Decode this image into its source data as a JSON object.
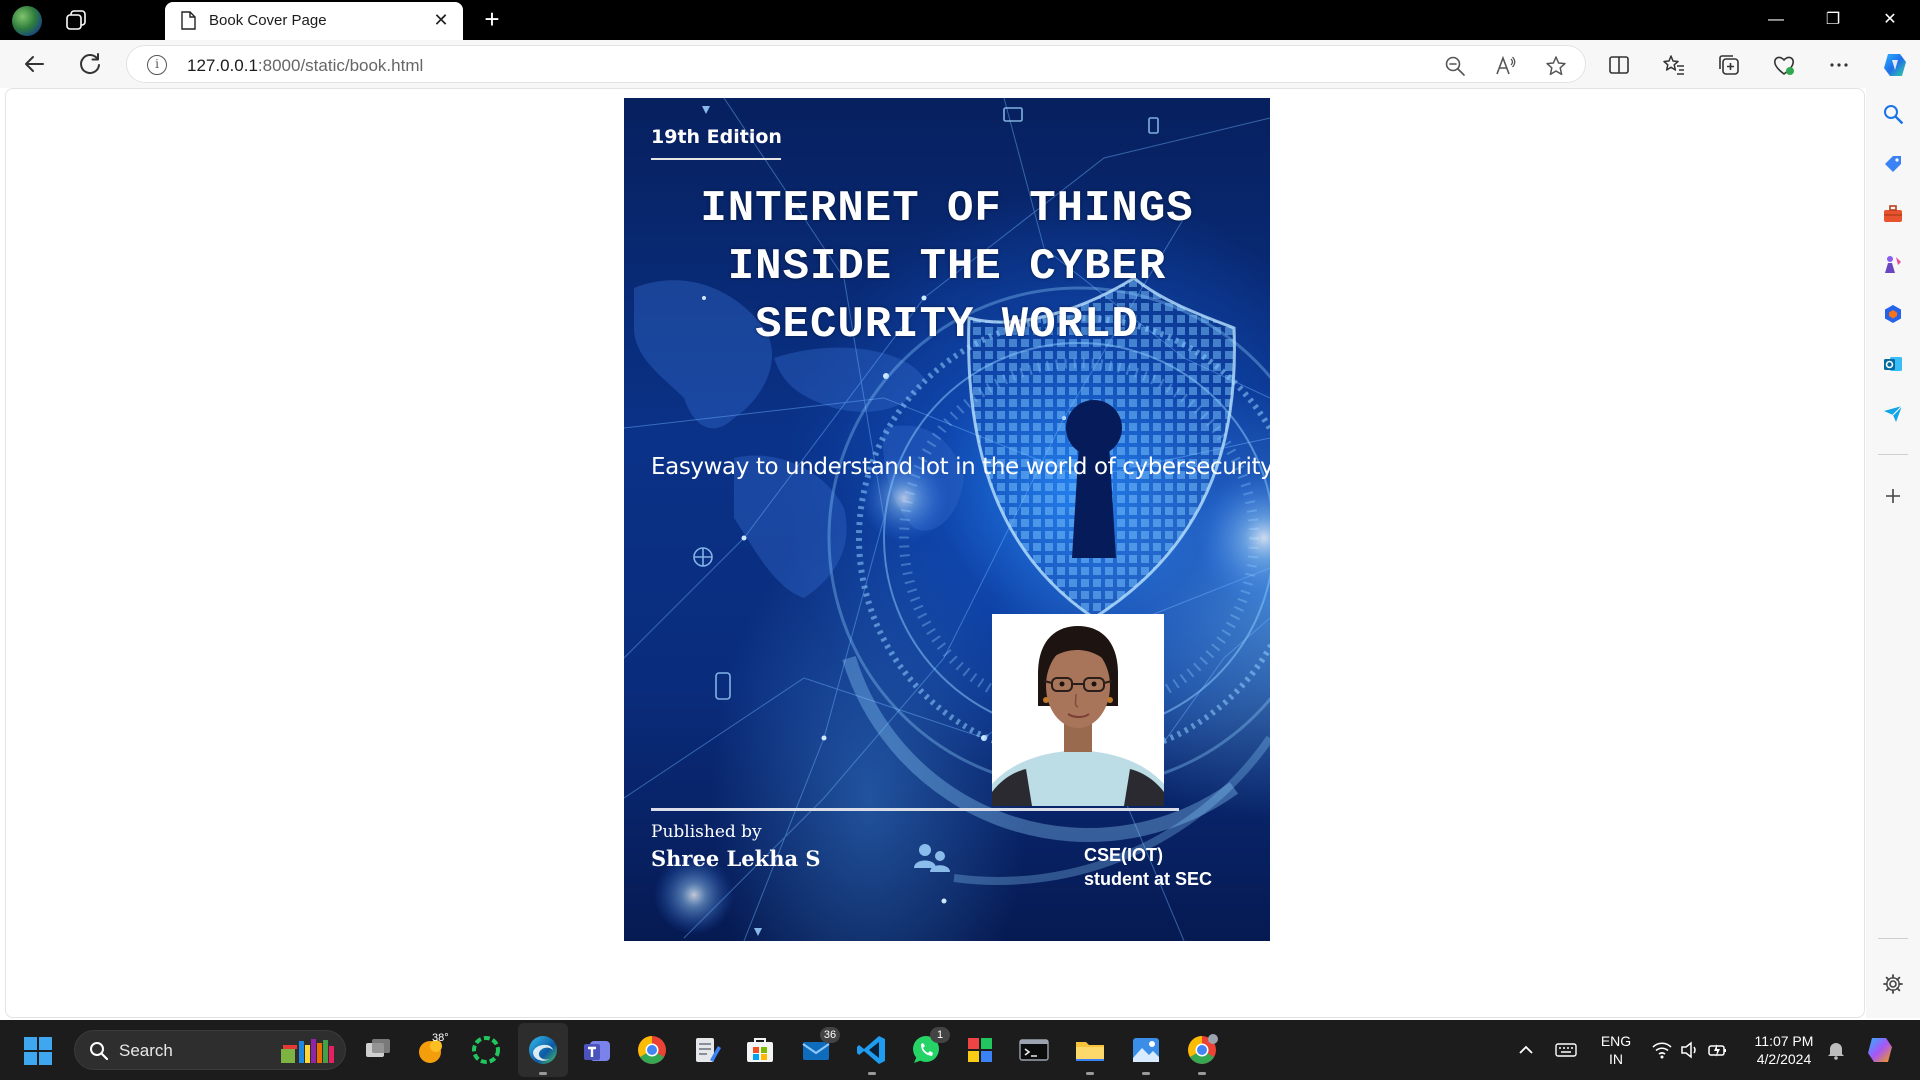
{
  "browser": {
    "tab": {
      "title": "Book Cover Page",
      "close_glyph": "✕"
    },
    "new_tab_glyph": "+",
    "window_controls": {
      "minimize": "—",
      "restore": "❐",
      "close": "✕"
    },
    "address": {
      "host": "127.0.0.1",
      "rest": ":8000/static/book.html"
    }
  },
  "book": {
    "edition": "19th Edition",
    "title_lines": [
      "INTERNET OF THINGS",
      "INSIDE THE CYBER",
      "SECURITY WORLD"
    ],
    "subtitle": "Easyway to understand Iot in the world of cybersecurity",
    "published_by": "Published by",
    "author": "Shree Lekha S",
    "role_lines": [
      "CSE(IOT)",
      "student at SEC"
    ]
  },
  "taskbar": {
    "search_label": "Search",
    "weather_temp": "38°",
    "teams_badge": "36",
    "whatsapp_badge": "1",
    "language": [
      "ENG",
      "IN"
    ],
    "time": "11:07 PM",
    "date": "4/2/2024"
  },
  "colors": {
    "cover_base": "#0a3288",
    "accent": "#3ea7f0",
    "taskbar": "#1c1c1c"
  }
}
